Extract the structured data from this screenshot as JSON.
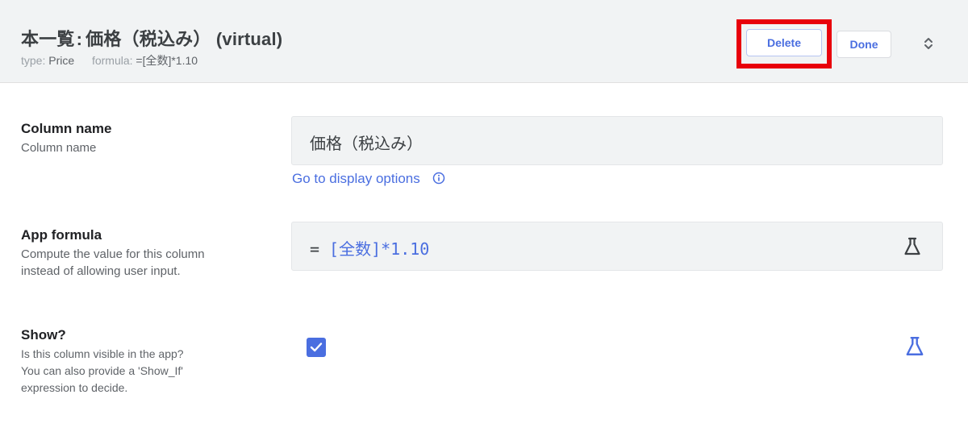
{
  "header": {
    "title_main": "本一覧",
    "title_sep": ":",
    "title_column": "価格（税込み）",
    "title_virtual": "(virtual)",
    "type_label": "type:",
    "type_value": "Price",
    "formula_label": "formula:",
    "formula_value": "=[全数]*1.10",
    "delete_label": "Delete",
    "done_label": "Done"
  },
  "column_name": {
    "title": "Column name",
    "description": "Column name",
    "value": "価格（税込み）",
    "link_label": "Go to display options"
  },
  "app_formula": {
    "title": "App formula",
    "description_line1": "Compute the value for this column",
    "description_line2": "instead of allowing user input.",
    "equals": "=",
    "expression": "[全数]*1.10"
  },
  "show": {
    "title": "Show?",
    "description_line1": "Is this column visible in the app?",
    "description_line2": "You can also provide a 'Show_If'",
    "description_line3": "expression to decide.",
    "checked": true
  },
  "colors": {
    "accent": "#4a6ee0",
    "highlight": "#e8000b",
    "header_bg": "#f1f3f4"
  },
  "icons": {
    "info": "info-circle-icon",
    "flask": "flask-icon",
    "chevron": "unfold-chevron-icon",
    "check": "check-icon"
  }
}
